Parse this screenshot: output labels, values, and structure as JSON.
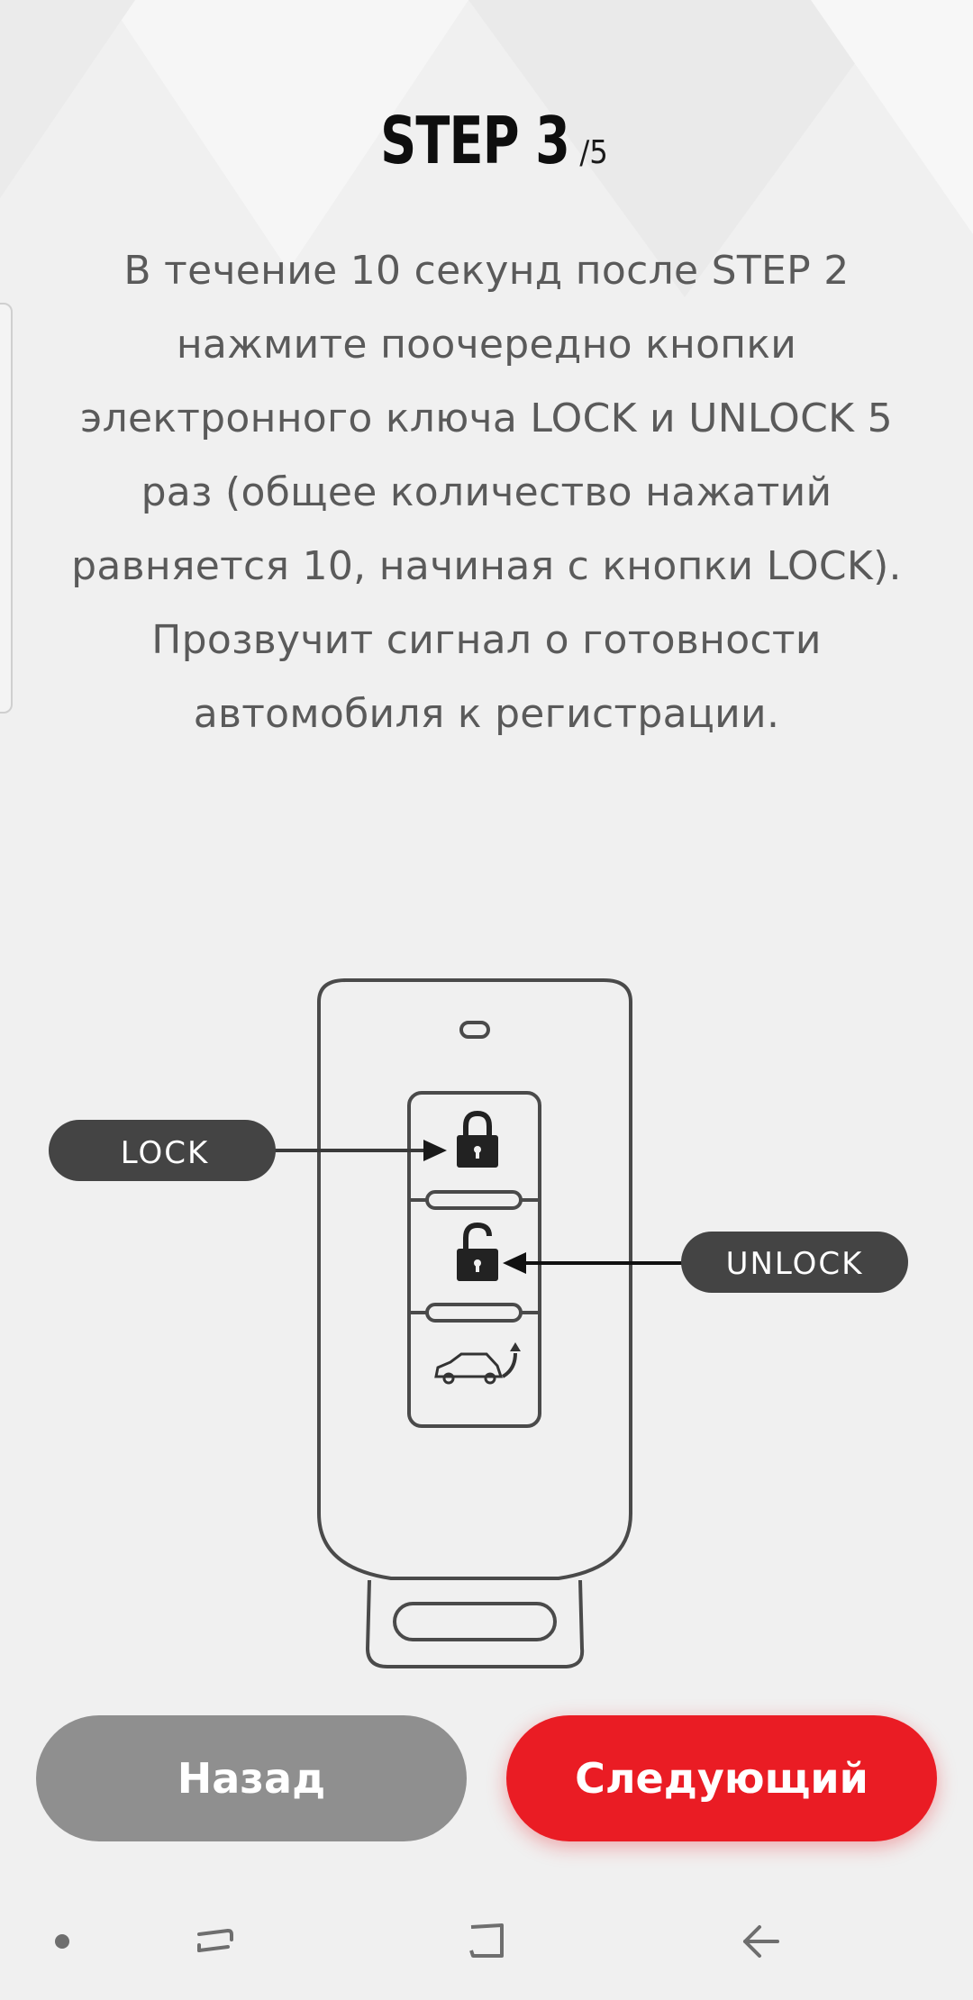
{
  "header": {
    "step_main": "STEP 3",
    "step_total": "/5"
  },
  "instructions": {
    "paragraph1": "В течение 10 секунд после STEP 2 нажмите поочередно кнопки электронного ключа LOCK и UNLOCK 5 раз (общее количество нажатий равняется 10, начиная с кнопки LOCK).",
    "paragraph2": "Прозвучит сигнал о готовности автомобиля к регистрации."
  },
  "diagram": {
    "lock_label": "LOCK",
    "unlock_label": "UNLOCK"
  },
  "buttons": {
    "back_label": "Назад",
    "next_label": "Следующий"
  },
  "colors": {
    "accent": "#ea1c24",
    "secondary_button": "#8f8f8f",
    "label_pill": "#444444",
    "background": "#f0f0f0"
  },
  "navigation": {
    "icons": [
      "dot-icon",
      "recent-apps-icon",
      "home-icon",
      "back-icon"
    ]
  }
}
